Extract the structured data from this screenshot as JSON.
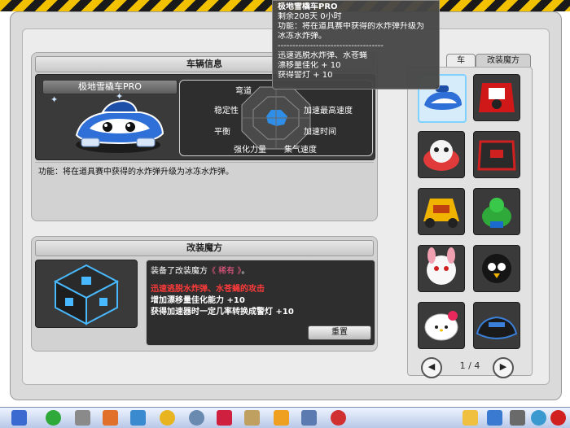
{
  "window": {
    "title_fragment": "车"
  },
  "vehicle_info": {
    "header": "车辆信息",
    "car_name": "极地雪橇车PRO",
    "stats": [
      "弯道",
      "稳定性",
      "加速最高速度",
      "平衡",
      "加速时间",
      "强化力量",
      "集气速度"
    ],
    "description": "功能：将在道具赛中获得的水炸弹升级为冰冻水炸弹。"
  },
  "mod_magic": {
    "header": "改装魔方",
    "equipped_prefix": "装备了改装魔方",
    "equipped_name": "《 稀有 》",
    "equipped_suffix": "。",
    "line_red": "迅速逃脱水炸弹、水苍蝇的攻击",
    "line_1": "增加漂移量佳化能力 +10",
    "line_2": "获得加速器时一定几率转换成警灯 +10",
    "reset_button": "重置"
  },
  "right_panel": {
    "tabs": [
      "车",
      "改装魔方"
    ],
    "active_tab": 0,
    "pagination": "1 / 4",
    "prev_icon": "◀",
    "next_icon": "▶"
  },
  "tooltip": {
    "title": "极地雪橇车PRO",
    "remaining": "剩余208天 0小时",
    "function_line1": "功能：将在道具赛中获得的水炸弹升级为",
    "function_line2": "冰冻水炸弹。",
    "separator": "------------------------------------",
    "bonus1": "迅速逃脱水炸弹、水苍蝇",
    "bonus2": "漂移量佳化 + 10",
    "bonus3": "获得警灯 + 10"
  },
  "colors": {
    "hazard_yellow": "#f2c200",
    "selected_border": "#7fd2ff",
    "red_text": "#ff3a3a",
    "rare_text": "#ff5a8a"
  }
}
